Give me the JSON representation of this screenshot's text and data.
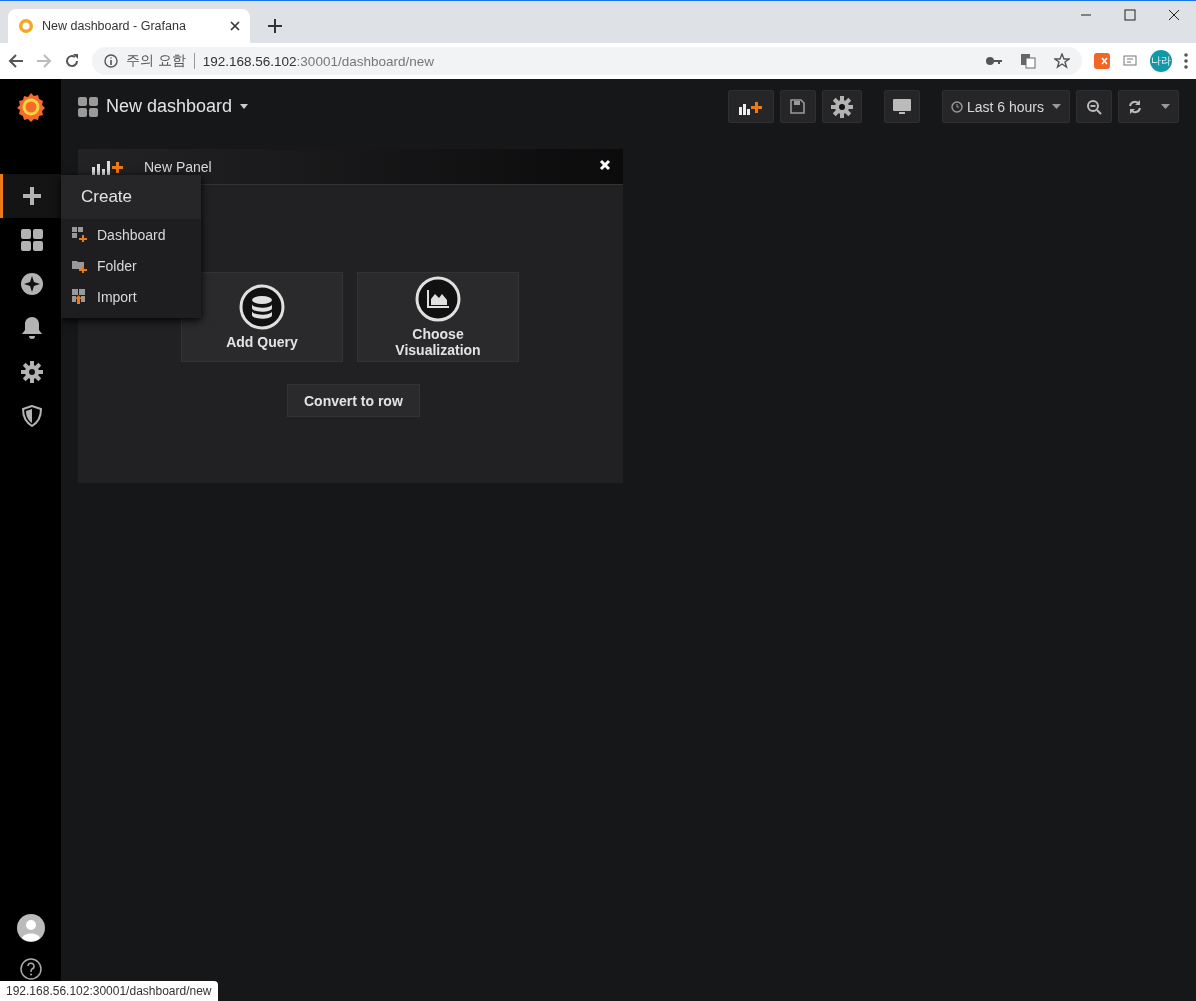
{
  "browser": {
    "tab_title": "New dashboard - Grafana",
    "security_label": "주의 요함",
    "url": {
      "host": "192.168.56.102",
      "path": ":30001/dashboard/new"
    },
    "profile": "나라"
  },
  "sidebar": {
    "items": [
      {
        "kind": "create",
        "selected": true
      },
      {
        "kind": "dashboards",
        "selected": false
      },
      {
        "kind": "explore",
        "selected": false
      },
      {
        "kind": "alerting",
        "selected": false
      },
      {
        "kind": "configuration",
        "selected": false
      },
      {
        "kind": "admin",
        "selected": false
      }
    ]
  },
  "create_menu": {
    "title": "Create",
    "items": [
      {
        "kind": "dashboard",
        "label": "Dashboard"
      },
      {
        "kind": "folder",
        "label": "Folder"
      },
      {
        "kind": "import",
        "label": "Import"
      }
    ]
  },
  "topbar": {
    "title": "New dashboard",
    "time_range": "Last 6 hours"
  },
  "panel": {
    "title": "New Panel",
    "actions": [
      {
        "kind": "query",
        "label": "Add Query"
      },
      {
        "kind": "visualization",
        "label": "Choose Visualization"
      }
    ],
    "convert_button": "Convert to row"
  },
  "status_bar": "192.168.56.102:30001/dashboard/new"
}
